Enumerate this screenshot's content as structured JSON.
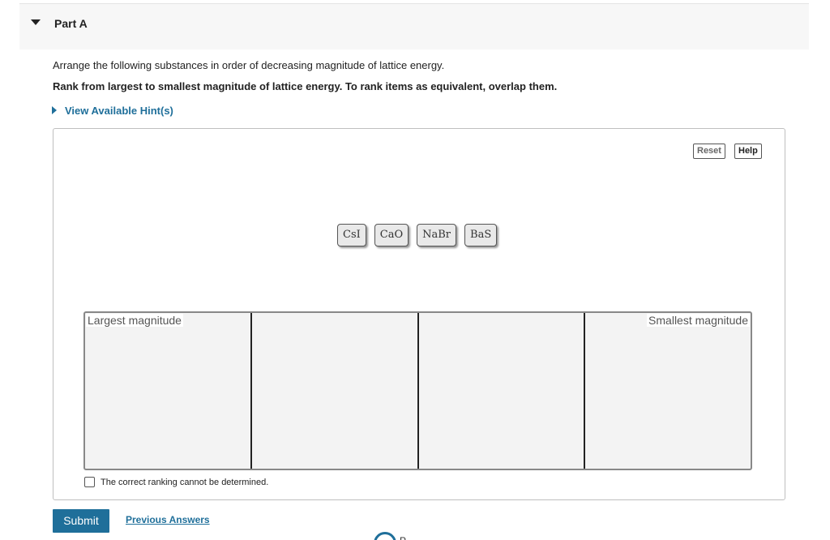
{
  "part": {
    "title": "Part A"
  },
  "question": {
    "instruction": "Arrange the following substances in order of decreasing magnitude of lattice energy.",
    "instruction_bold": "Rank from largest to smallest magnitude of lattice energy. To rank items as equivalent, overlap them.",
    "hint_label": "View Available Hint(s)"
  },
  "widget": {
    "reset_label": "Reset",
    "help_label": "Help",
    "items": [
      "CsI",
      "CaO",
      "NaBr",
      "BaS"
    ],
    "bin_left_label": "Largest magnitude",
    "bin_right_label": "Smallest magnitude",
    "cannot_determine_label": "The correct ranking cannot be determined."
  },
  "footer": {
    "submit_label": "Submit",
    "previous_answers_label": "Previous Answers",
    "feedback_letter": "P"
  }
}
